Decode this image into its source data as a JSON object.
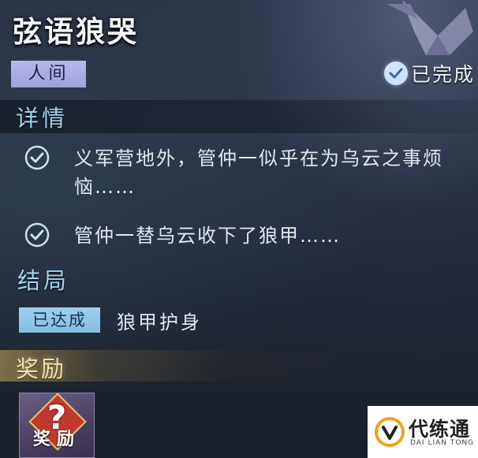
{
  "quest": {
    "title": "弦语狼哭",
    "realm_tag": "人间",
    "status": "已完成"
  },
  "details": {
    "heading": "详情",
    "items": [
      {
        "text": "义军营地外，管仲一似乎在为乌云之事烦恼……",
        "checked": true
      },
      {
        "text": "管仲一替乌云收下了狼甲……",
        "checked": true
      }
    ]
  },
  "ending": {
    "heading": "结局",
    "status_tag": "已达成",
    "name": "狼甲护身"
  },
  "reward": {
    "heading": "奖励",
    "item_label": "奖励",
    "item_mark": "?"
  },
  "watermark": {
    "name": "代练通",
    "sub": "DAI LIAN TONG"
  },
  "colors": {
    "section_heading": "#9fd2ee",
    "realm_tag_bg": "#b7b8ea",
    "achieved_tag_bg": "#9fd0ef",
    "reward_heading": "#f1e1b0"
  }
}
